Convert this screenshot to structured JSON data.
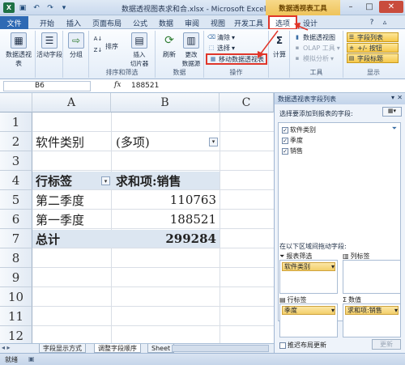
{
  "window": {
    "title": "数据透视图表求和合.xlsx - Microsoft Excel",
    "context_title": "数据透视表工具"
  },
  "tabs": [
    "文件",
    "开始",
    "插入",
    "页面布局",
    "公式",
    "数据",
    "审阅",
    "视图",
    "开发工具",
    "选项",
    "设计"
  ],
  "ribbon": {
    "pivot_table": "数据透视表",
    "active_field": "活动字段",
    "group": "分组",
    "sort": "排序",
    "insert_slicer": "插入\n切片器",
    "group_sort_label": "排序和筛选",
    "refresh": "刷新",
    "change_source": "更改\n数据源",
    "data_label": "数据",
    "clear": "清除",
    "select": "选择",
    "move_pivot": "移动数据透视表",
    "actions_label": "操作",
    "calculate": "计算",
    "pivot_chart": "数据透视图",
    "olap_tools": "OLAP 工具",
    "what_if": "模拟分析",
    "tools_label": "工具",
    "field_list": "字段列表",
    "plus_minus": "+/- 按钮",
    "field_headers": "字段标题",
    "show_label": "显示"
  },
  "formula_bar": {
    "name_box": "B6",
    "fx": "fx",
    "value": "188521"
  },
  "sheet": {
    "columns": [
      "A",
      "B",
      "C"
    ],
    "rows": [
      "1",
      "2",
      "3",
      "4",
      "5",
      "6",
      "7",
      "8",
      "9",
      "10",
      "11",
      "12"
    ],
    "filter_label": "软件类别",
    "filter_value": "(多项)",
    "row_label_header": "行标签",
    "sum_header": "求和项:销售",
    "data_rows": [
      {
        "label": "第二季度",
        "value": "110763"
      },
      {
        "label": "第一季度",
        "value": "188521"
      }
    ],
    "total_label": "总计",
    "total_value": "299284"
  },
  "sheet_tabs": [
    "字段显示方式",
    "调整字段顺序",
    "Sheet"
  ],
  "status": {
    "ready": "就绪"
  },
  "pane": {
    "title": "数据透视表字段列表",
    "choose_fields": "选择要添加到报表的字段:",
    "fields": [
      {
        "name": "软件类别",
        "checked": true
      },
      {
        "name": "季度",
        "checked": true
      },
      {
        "name": "销售",
        "checked": true
      }
    ],
    "drag_label": "在以下区域间拖动字段:",
    "report_filter": "报表筛选",
    "column_labels": "列标签",
    "row_labels": "行标签",
    "values": "数值",
    "filter_chip": "软件类别",
    "row_chip": "季度",
    "value_chip": "求和项:销售",
    "defer_update": "推迟布局更新",
    "update_button": "更新"
  }
}
